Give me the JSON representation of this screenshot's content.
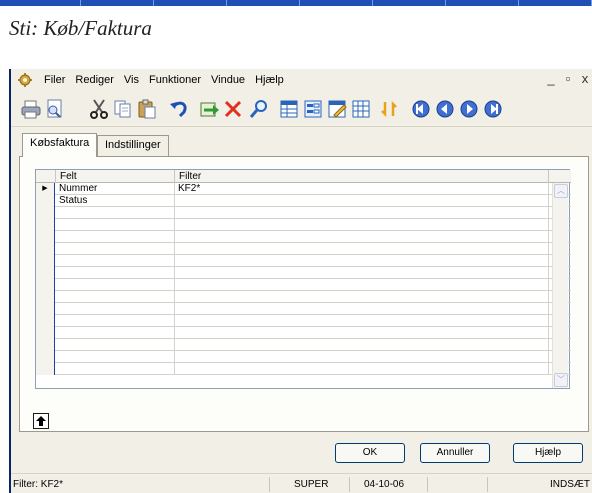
{
  "caption": "Sti: Køb/Faktura",
  "menubar": {
    "items": [
      "Filer",
      "Rediger",
      "Vis",
      "Funktioner",
      "Vindue",
      "Hjælp"
    ],
    "minimize": "_",
    "restore": "▫",
    "close": "x"
  },
  "toolbar": {
    "icons": [
      "print-icon",
      "print-preview-icon",
      "cut-icon",
      "copy-icon",
      "paste-icon",
      "undo-icon",
      "new-record-icon",
      "delete-icon",
      "search-icon",
      "table-view-icon",
      "form-view-icon",
      "edit-view-icon",
      "grid-icon",
      "refresh-icon",
      "first-icon",
      "previous-icon",
      "next-icon",
      "last-icon"
    ]
  },
  "tabs": [
    "Købsfaktura",
    "Indstillinger"
  ],
  "grid": {
    "columns": [
      "Felt",
      "Filter"
    ],
    "rows": [
      {
        "felt": "Nummer",
        "filter": "KF2*",
        "indicator": "▶"
      },
      {
        "felt": "Status",
        "filter": "",
        "indicator": ""
      }
    ],
    "empty_rows": 14
  },
  "buttons": {
    "ok": "OK",
    "cancel": "Annuller",
    "help": "Hjælp"
  },
  "statusbar": {
    "filter": "Filter: KF2*",
    "user": "SUPER",
    "date": "04-10-06",
    "mode": "INDSÆT"
  },
  "colors": {
    "title_blue": "#1f4fb4",
    "window_bg": "#f1efe6",
    "button_border": "#003c74"
  }
}
